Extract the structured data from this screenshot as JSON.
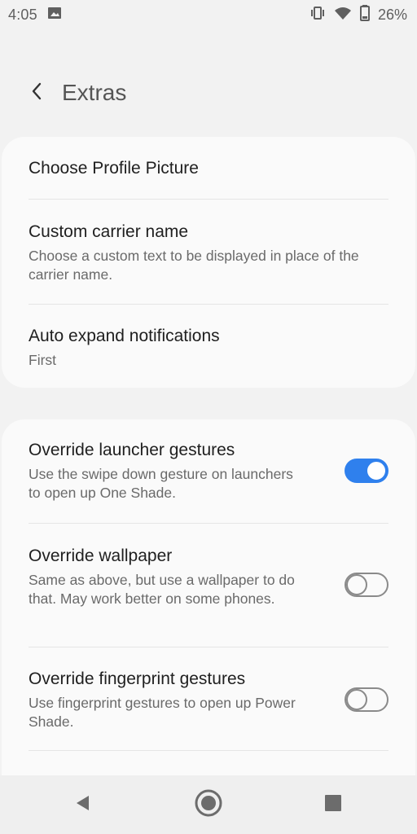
{
  "status_bar": {
    "time": "4:05",
    "battery": "26%",
    "icons": [
      "image-notification-icon",
      "vibrate-icon",
      "wifi-icon",
      "battery-icon"
    ]
  },
  "header": {
    "title": "Extras",
    "back_icon": "back-arrow-icon"
  },
  "card_1": {
    "items": [
      {
        "title": "Choose Profile Picture",
        "summary": ""
      },
      {
        "title": "Custom carrier name",
        "summary": "Choose a custom text to be displayed in place of the carrier name."
      },
      {
        "title": "Auto expand notifications",
        "summary": "First"
      }
    ]
  },
  "card_2": {
    "items": [
      {
        "title": "Override launcher gestures",
        "summary": "Use the swipe down gesture on launchers to open up One Shade.",
        "enabled": true
      },
      {
        "title": "Override wallpaper",
        "summary": "Same as above, but use a wallpaper to do that. May work better on some phones.",
        "enabled": false
      },
      {
        "title": "Override fingerprint gestures",
        "summary": "Use fingerprint gestures to open up Power Shade.",
        "enabled": false
      }
    ]
  },
  "nav_bar": {
    "icons": [
      "back-triangle-icon",
      "home-circle-icon",
      "recent-square-icon"
    ]
  },
  "colors": {
    "accent": "#2f80ed",
    "background": "#f2f2f2",
    "card": "#fafafa"
  }
}
